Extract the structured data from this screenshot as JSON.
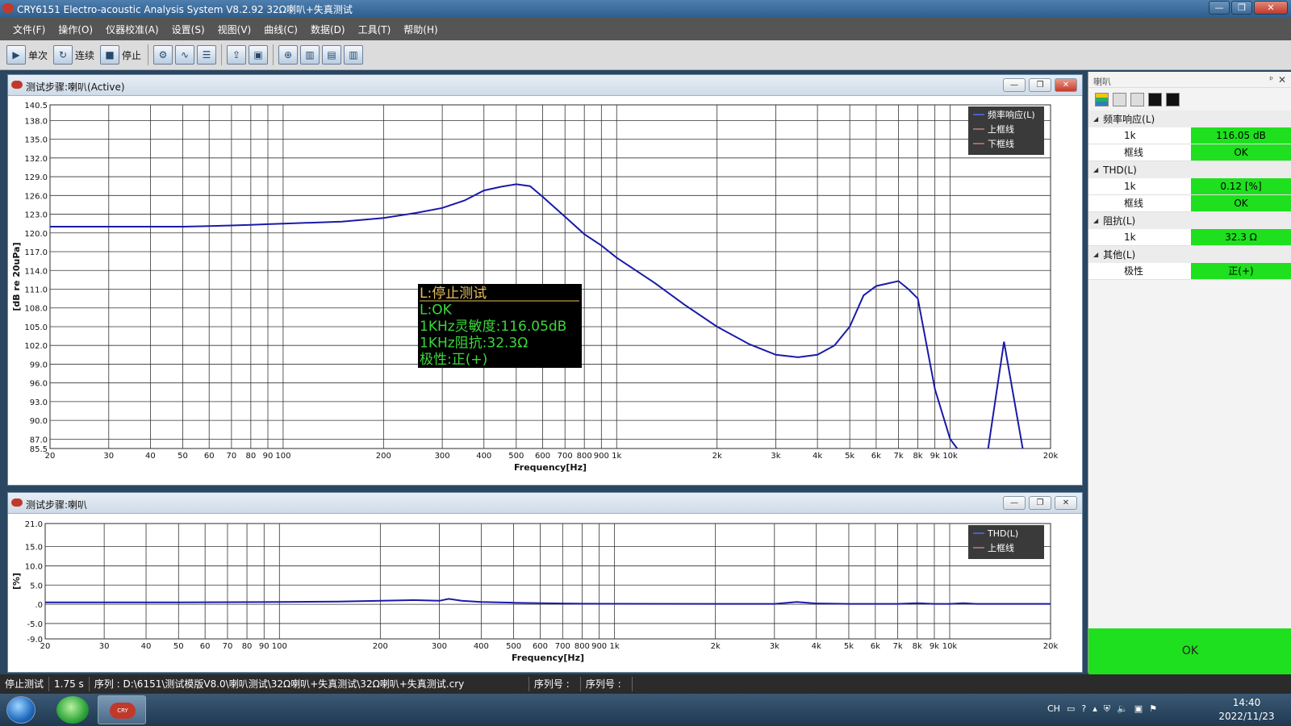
{
  "window": {
    "title": "CRY6151 Electro-acoustic Analysis System  V8.2.92 32Ω喇叭+失真测试",
    "buttons": {
      "minimize": "—",
      "restore": "❐",
      "close": "✕"
    }
  },
  "menu": [
    "文件(F)",
    "操作(O)",
    "仪器校准(A)",
    "设置(S)",
    "视图(V)",
    "曲线(C)",
    "数据(D)",
    "工具(T)",
    "帮助(H)"
  ],
  "toolbar": {
    "single": "单次",
    "continuous": "连续",
    "stop": "停止"
  },
  "panel1": {
    "title": "测试步骤:喇叭(Active)",
    "ylabel": "[dB re 20uPa]",
    "xlabel": "Frequency[Hz]",
    "overlay": {
      "line1": "L:停止测试",
      "line2": "L:OK",
      "line3": "1KHz灵敏度:116.05dB",
      "line4": "1KHz阻抗:32.3Ω",
      "line5": "极性:正(+)"
    }
  },
  "panel2": {
    "title": "测试步骤:喇叭",
    "ylabel": "[%]",
    "xlabel": "Frequency[Hz]"
  },
  "chart_data": [
    {
      "type": "line",
      "xscale": "log",
      "xlim": [
        20,
        20000
      ],
      "ylim": [
        85.5,
        140.5
      ],
      "grid": true,
      "legend_position": "top-right",
      "xlabel": "Frequency[Hz]",
      "ylabel": "[dB re 20uPa]",
      "xticks": [
        20,
        30,
        40,
        50,
        60,
        70,
        80,
        90,
        100,
        200,
        300,
        400,
        500,
        600,
        700,
        800,
        900,
        1000,
        2000,
        3000,
        4000,
        5000,
        6000,
        7000,
        8000,
        9000,
        10000,
        20000
      ],
      "xtick_labels": [
        "20",
        "30",
        "40",
        "50",
        "60",
        "70",
        "80",
        "90",
        "100",
        "200",
        "300",
        "400",
        "500",
        "600",
        "700",
        "800",
        "900",
        "1k",
        "2k",
        "3k",
        "4k",
        "5k",
        "6k",
        "7k",
        "8k",
        "9k",
        "10k",
        "20k"
      ],
      "yticks": [
        85.5,
        87.0,
        90.0,
        93.0,
        96.0,
        99.0,
        102.0,
        105.0,
        108.0,
        111.0,
        114.0,
        117.0,
        120.0,
        123.0,
        126.0,
        129.0,
        132.0,
        135.0,
        138.0,
        140.5
      ],
      "ytick_labels": [
        "85.5",
        "87.0",
        "90.0",
        "93.0",
        "96.0",
        "99.0",
        "102.0",
        "105.0",
        "108.0",
        "111.0",
        "114.0",
        "117.0",
        "120.0",
        "123.0",
        "126.0",
        "129.0",
        "132.0",
        "135.0",
        "138.0",
        "140.5"
      ],
      "series": [
        {
          "name": "频率响应(L)",
          "color": "#1a1aa8",
          "x": [
            20,
            30,
            50,
            60,
            70,
            80,
            90,
            100,
            150,
            200,
            250,
            300,
            350,
            400,
            450,
            500,
            550,
            600,
            700,
            800,
            900,
            1000,
            1300,
            1600,
            2000,
            2500,
            3000,
            3500,
            4000,
            4500,
            5000,
            5500,
            6000,
            7000,
            7500,
            8000,
            9000,
            10000,
            10500
          ],
          "y": [
            121.0,
            121.0,
            121.0,
            121.1,
            121.2,
            121.3,
            121.4,
            121.5,
            121.8,
            122.4,
            123.2,
            124.0,
            125.2,
            126.8,
            127.4,
            127.8,
            127.5,
            125.8,
            122.6,
            119.8,
            118.0,
            116.05,
            112.0,
            108.5,
            105.0,
            102.2,
            100.5,
            100.1,
            100.5,
            102.0,
            105.0,
            110.0,
            111.5,
            112.3,
            111.0,
            109.5,
            95.0,
            87.0,
            85.5
          ]
        },
        {
          "name": "",
          "color": "#1a1aa8",
          "x": [
            13000,
            14500,
            16500
          ],
          "y": [
            85.5,
            102.6,
            85.5
          ]
        },
        {
          "name": "上框线",
          "color": "#c08080",
          "x": [],
          "y": []
        },
        {
          "name": "下框线",
          "color": "#c08080",
          "x": [],
          "y": []
        }
      ]
    },
    {
      "type": "line",
      "xscale": "log",
      "xlim": [
        20,
        20000
      ],
      "ylim": [
        -9.0,
        21.0
      ],
      "grid": true,
      "legend_position": "top-right",
      "xlabel": "Frequency[Hz]",
      "ylabel": "[%]",
      "xticks": [
        20,
        30,
        40,
        50,
        60,
        70,
        80,
        90,
        100,
        200,
        300,
        400,
        500,
        600,
        700,
        800,
        900,
        1000,
        2000,
        3000,
        4000,
        5000,
        6000,
        7000,
        8000,
        9000,
        10000,
        20000
      ],
      "xtick_labels": [
        "20",
        "30",
        "40",
        "50",
        "60",
        "70",
        "80",
        "90",
        "100",
        "200",
        "300",
        "400",
        "500",
        "600",
        "700",
        "800",
        "900",
        "1k",
        "2k",
        "3k",
        "4k",
        "5k",
        "6k",
        "7k",
        "8k",
        "9k",
        "10k",
        "20k"
      ],
      "yticks": [
        -9.0,
        -5.0,
        0,
        5.0,
        10.0,
        15.0,
        21.0
      ],
      "ytick_labels": [
        "-9.0",
        "-5.0",
        ".0",
        "5.0",
        "10.0",
        "15.0",
        "21.0"
      ],
      "series": [
        {
          "name": "THD(L)",
          "color": "#1a1aa8",
          "x": [
            20,
            50,
            100,
            150,
            200,
            250,
            300,
            320,
            350,
            400,
            500,
            600,
            700,
            800,
            1000,
            2000,
            3000,
            3500,
            4000,
            5000,
            7000,
            8000,
            9000,
            10000,
            11000,
            12000,
            20000
          ],
          "y": [
            0.5,
            0.5,
            0.6,
            0.7,
            0.9,
            1.1,
            0.9,
            1.4,
            0.9,
            0.6,
            0.4,
            0.3,
            0.2,
            0.15,
            0.12,
            0.1,
            0.1,
            0.6,
            0.2,
            0.1,
            0.1,
            0.3,
            0.1,
            0.1,
            0.3,
            0.1,
            0.1
          ]
        },
        {
          "name": "上框线",
          "color": "#c08080",
          "x": [],
          "y": []
        }
      ]
    }
  ],
  "props": {
    "title": "喇叭",
    "pin": "ᵖ",
    "close": "✕",
    "groups": [
      {
        "name": "频率响应(L)",
        "rows": [
          {
            "k": "1k",
            "v": "116.05 dB"
          },
          {
            "k": "框线",
            "v": "OK"
          }
        ]
      },
      {
        "name": "THD(L)",
        "rows": [
          {
            "k": "1k",
            "v": "0.12 [%]"
          },
          {
            "k": "框线",
            "v": "OK"
          }
        ]
      },
      {
        "name": "阻抗(L)",
        "rows": [
          {
            "k": "1k",
            "v": "32.3 Ω"
          }
        ]
      },
      {
        "name": "其他(L)",
        "rows": [
          {
            "k": "极性",
            "v": "正(+)"
          }
        ]
      }
    ],
    "result": "OK"
  },
  "status": {
    "state": "停止测试",
    "time": "1.75 s",
    "sequence": "序列 : D:\\6151\\测试模版V8.0\\喇叭测试\\32Ω喇叭+失真测试\\32Ω喇叭+失真测试.cry",
    "serial1": "序列号 :",
    "serial2": "序列号 :"
  },
  "taskbar": {
    "app_logo": "CRY",
    "tray": {
      "lang": "CH",
      "help": "?"
    },
    "time": "14:40",
    "date": "2022/11/23"
  },
  "colors": {
    "pass": "#1ee01e",
    "curve": "#1a1aa8",
    "limit": "#c08080",
    "overlay_bg": "#000000",
    "overlay_title": "#e8c05a",
    "overlay_text": "#3ad83a"
  }
}
